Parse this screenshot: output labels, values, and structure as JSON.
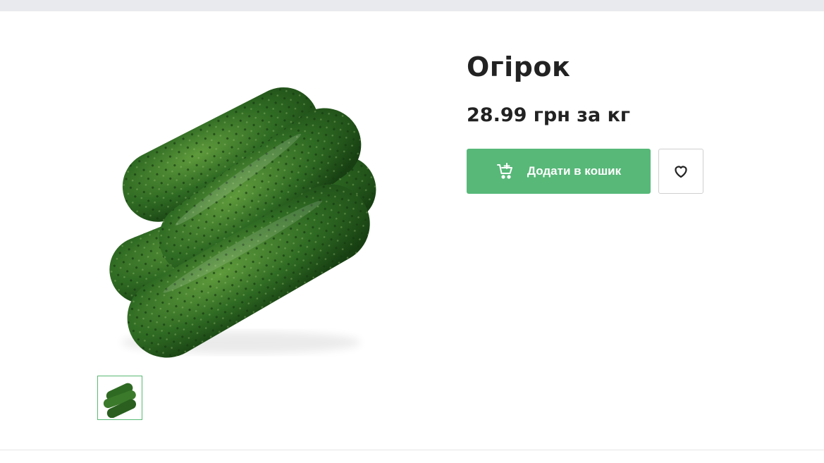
{
  "product": {
    "title": "Огірок",
    "price": "28.99 грн за кг",
    "image_alt": "cucumbers"
  },
  "actions": {
    "add_to_cart_label": "Додати в кошик",
    "add_to_cart_icon": "cart-add-icon",
    "favorite_icon": "heart-icon"
  },
  "gallery": {
    "thumbnails": [
      "cucumbers"
    ],
    "selected_index": 0
  },
  "colors": {
    "accent_green": "#57b878",
    "thumb_border": "#5ab974",
    "text": "#222222",
    "top_strip": "#e9eaee"
  }
}
